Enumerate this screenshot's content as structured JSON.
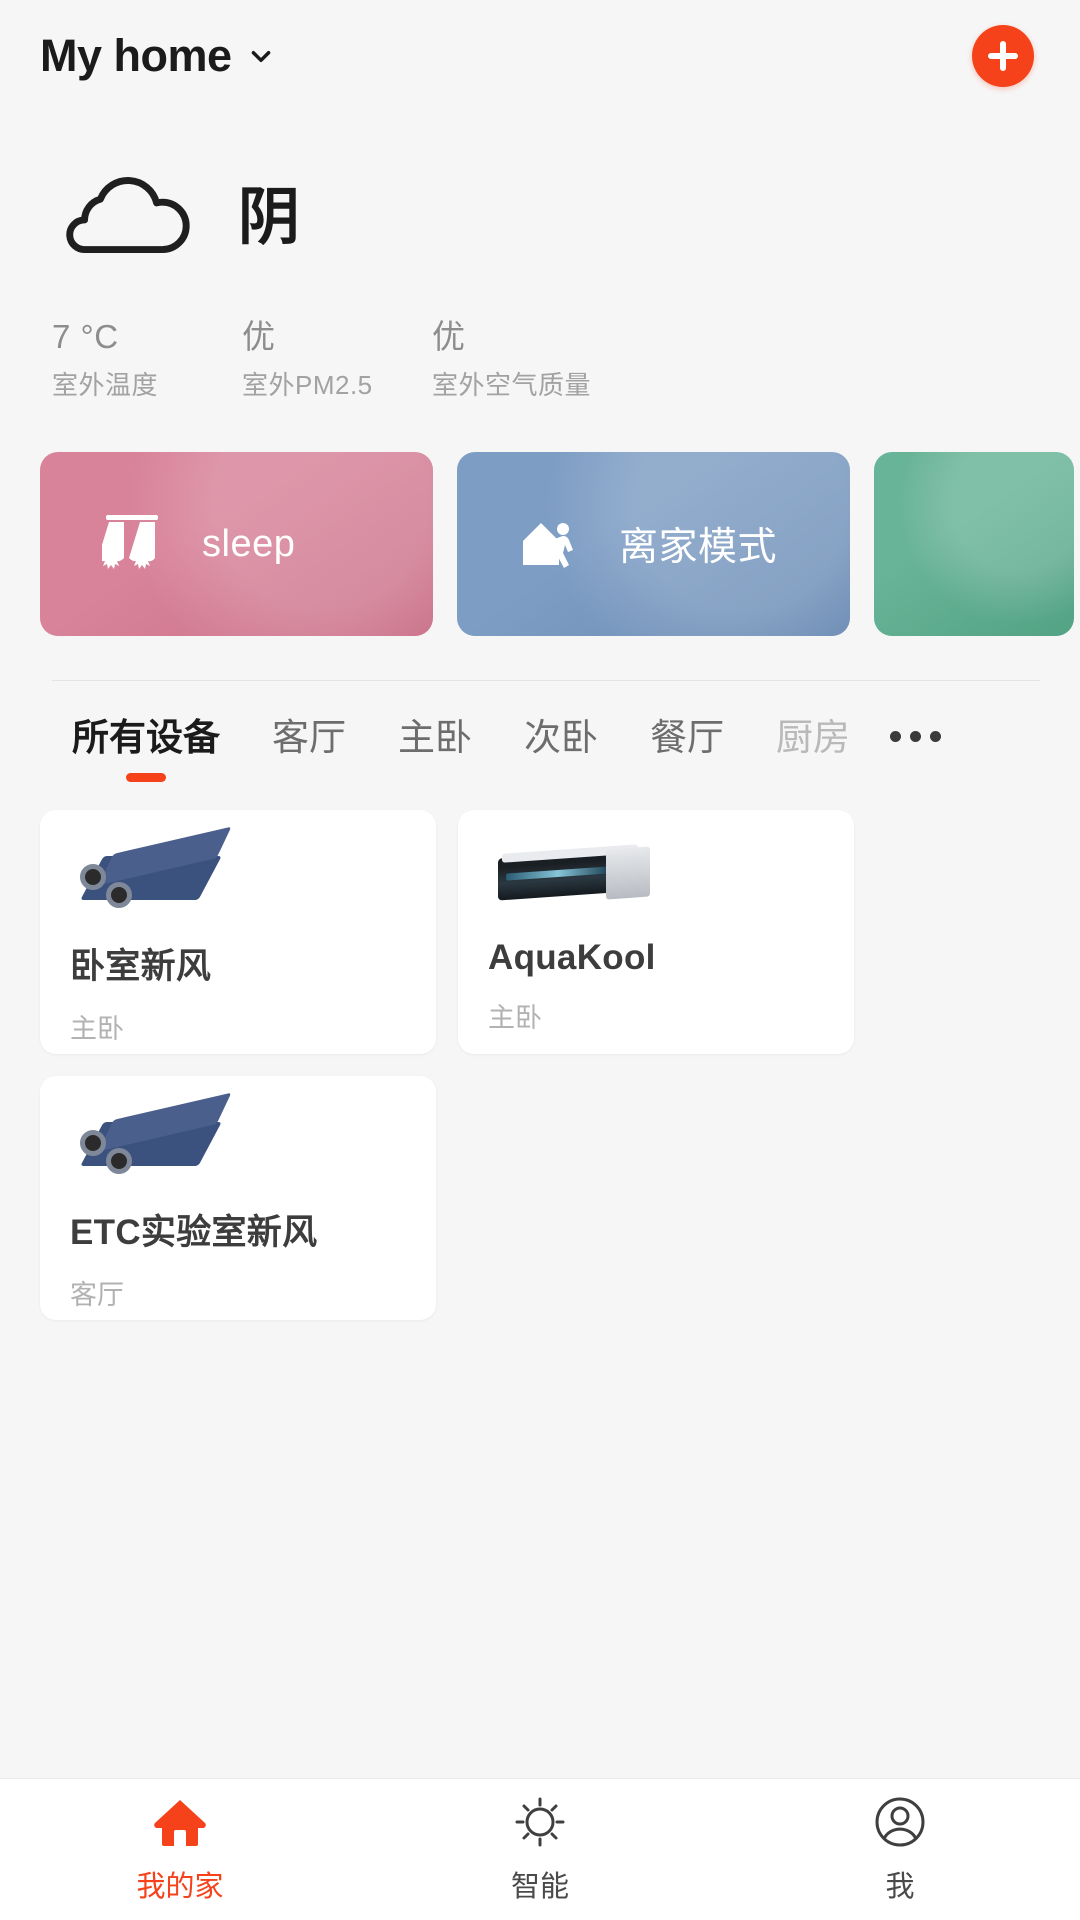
{
  "header": {
    "title": "My home",
    "chevron_icon": "chevron-down-icon",
    "add_icon": "plus-icon",
    "accent_color": "#f5421a"
  },
  "weather": {
    "icon": "cloud-icon",
    "condition": "阴",
    "stats": [
      {
        "value": "7 °C",
        "label": "室外温度"
      },
      {
        "value": "优",
        "label": "室外PM2.5"
      },
      {
        "value": "优",
        "label": "室外空气质量"
      }
    ]
  },
  "scenes": [
    {
      "label": "sleep",
      "icon": "curtains-icon",
      "color": "#d4758f"
    },
    {
      "label": "离家模式",
      "icon": "leave-home-icon",
      "color": "#6f92bd"
    },
    {
      "label": "",
      "icon": "",
      "color": "#57ab8c"
    }
  ],
  "tabs": {
    "items": [
      {
        "label": "所有设备",
        "active": true
      },
      {
        "label": "客厅",
        "active": false
      },
      {
        "label": "主卧",
        "active": false
      },
      {
        "label": "次卧",
        "active": false
      },
      {
        "label": "餐厅",
        "active": false
      },
      {
        "label": "厨房",
        "active": false,
        "muted": true
      }
    ],
    "more_icon": "more-horizontal-icon"
  },
  "devices": [
    {
      "name": "卧室新风",
      "room": "主卧",
      "image": "erv-unit-image"
    },
    {
      "name": "AquaKool",
      "room": "主卧",
      "image": "ducted-ac-image"
    },
    {
      "name": "ETC实验室新风",
      "room": "客厅",
      "image": "erv-unit-image"
    }
  ],
  "bottom_nav": [
    {
      "label": "我的家",
      "icon": "home-icon",
      "active": true
    },
    {
      "label": "智能",
      "icon": "sun-icon",
      "active": false
    },
    {
      "label": "我",
      "icon": "person-circle-icon",
      "active": false
    }
  ]
}
